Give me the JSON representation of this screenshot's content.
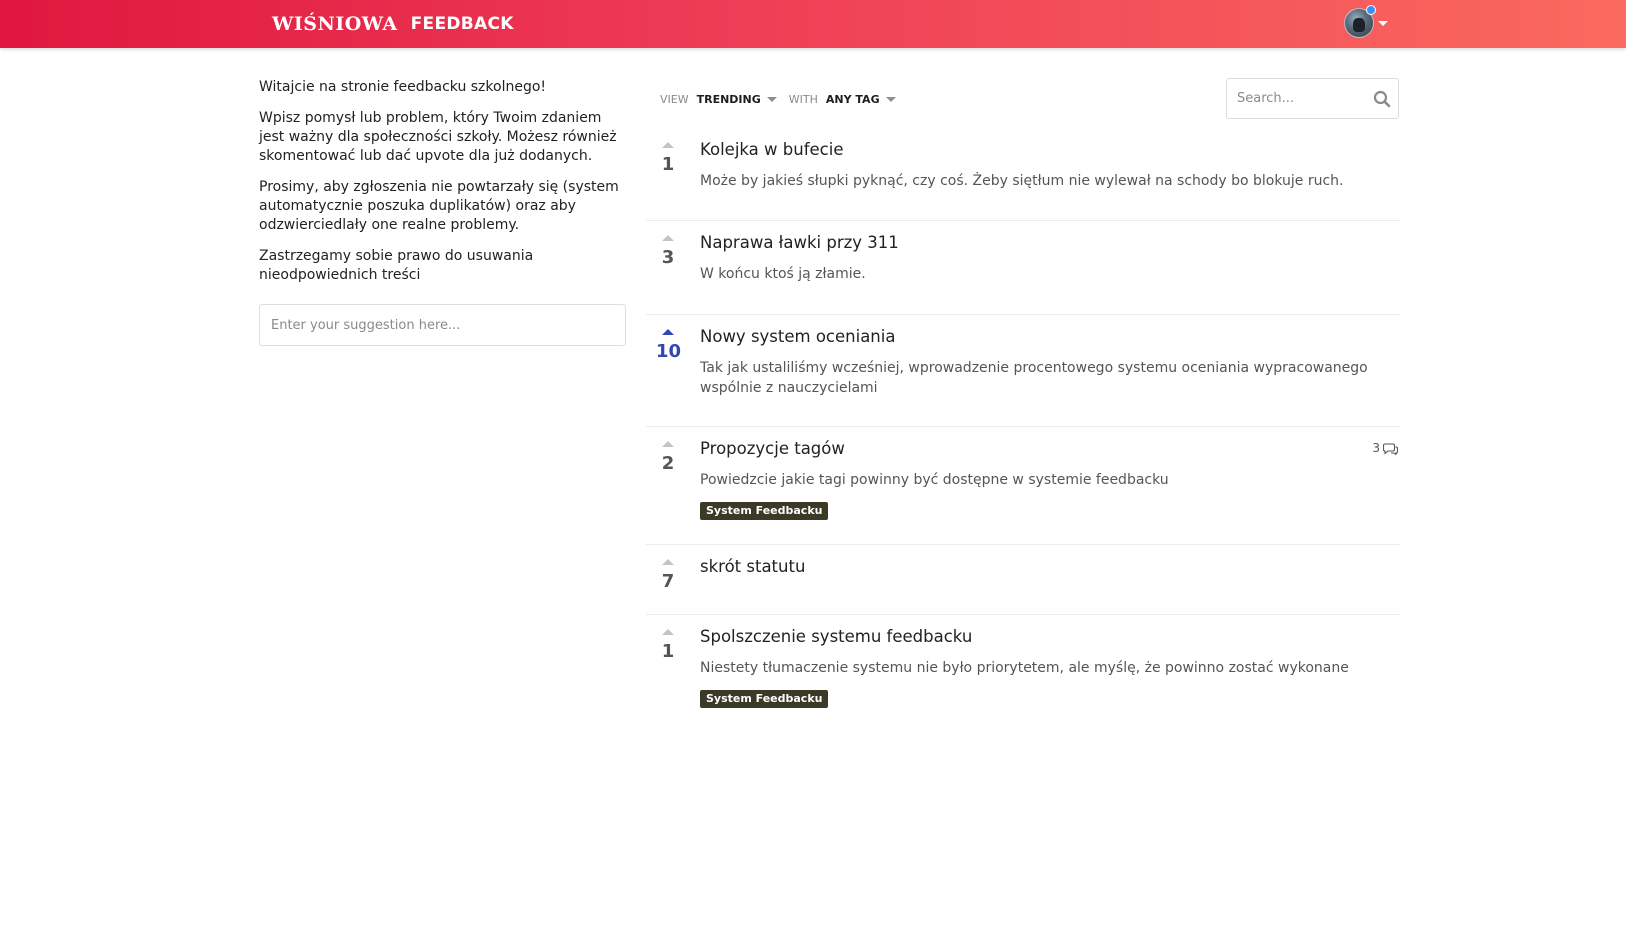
{
  "header": {
    "logo": "WIŚNIOWA",
    "product": "FEEDBACK",
    "accent_start": "#e0173f",
    "accent_end": "#fa6a5e"
  },
  "intro": {
    "p1": "Witajcie na stronie feedbacku szkolnego!",
    "p2": "Wpisz pomysł lub problem, który Twoim zdaniem jest ważny dla społeczności szkoły. Możesz również skomentować lub dać upvote dla już dodanych.",
    "p3": "Prosimy, aby zgłoszenia nie powtarzały się (system automatycznie poszuka duplikatów) oraz aby odzwierciedlały one realne problemy.",
    "p4": "Zastrzegamy sobie prawo do usuwania nieodpowiednich treści"
  },
  "suggestion": {
    "placeholder": "Enter your suggestion here...",
    "value": ""
  },
  "filters": {
    "view_label": "VIEW",
    "view_value": "TRENDING",
    "with_label": "WITH",
    "with_value": "ANY TAG"
  },
  "search": {
    "placeholder": "Search...",
    "value": ""
  },
  "posts": [
    {
      "votes": "1",
      "title": "Kolejka w bufecie",
      "description": "Może by jakieś słupki pyknąć, czy coś. Żeby siętłum nie wylewał na schody bo blokuje ruch."
    },
    {
      "votes": "3",
      "title": "Naprawa ławki przy 311",
      "description": "W końcu ktoś ją złamie."
    },
    {
      "votes": "10",
      "title": "Nowy system oceniania",
      "description": "Tak jak ustaliliśmy wcześniej, wprowadzenie procentowego systemu oceniania wypracowanego wspólnie z nauczycielami",
      "voted": true
    },
    {
      "votes": "2",
      "title": "Propozycje tagów",
      "description": "Powiedzcie jakie tagi powinny być dostępne w systemie feedbacku",
      "tag": "System Feedbacku",
      "comments": "3"
    },
    {
      "votes": "7",
      "title": "skrót statutu"
    },
    {
      "votes": "1",
      "title": "Spolszczenie systemu feedbacku",
      "description": "Niestety tłumaczenie systemu nie było priorytetem, ale myślę, że powinno zostać wykonane",
      "tag": "System Feedbacku"
    }
  ]
}
